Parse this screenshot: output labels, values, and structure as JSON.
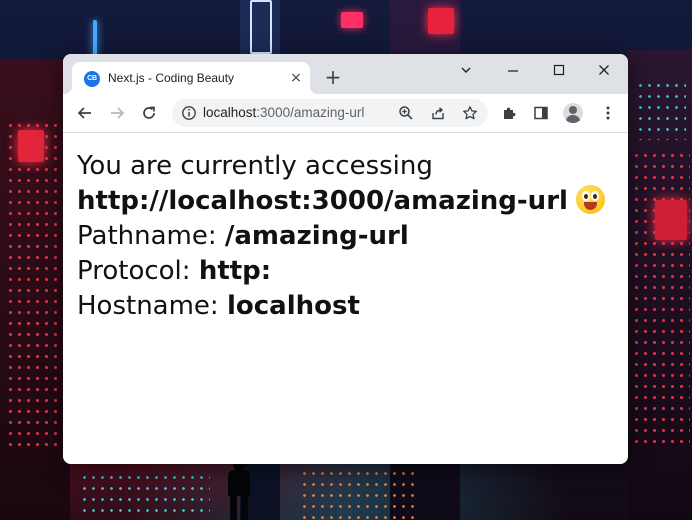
{
  "browser": {
    "tab": {
      "favicon_text": "CB",
      "title": "Next.js - Coding Beauty",
      "close_symbol": "×"
    },
    "new_tab_symbol": "+",
    "address_bar": {
      "host": "localhost",
      "rest": ":3000/amazing-url"
    }
  },
  "page": {
    "line1_text": "You are currently accessing",
    "line2_url": "http://localhost:3000/amazing-url",
    "pathname_label": "Pathname:",
    "pathname_value": "/amazing-url",
    "protocol_label": "Protocol:",
    "protocol_value": "http:",
    "hostname_label": "Hostname:",
    "hostname_value": "localhost"
  },
  "colors": {
    "tab_strip": "#dee1e6",
    "omnibox": "#f1f3f4",
    "favicon": "#1a73e8"
  }
}
